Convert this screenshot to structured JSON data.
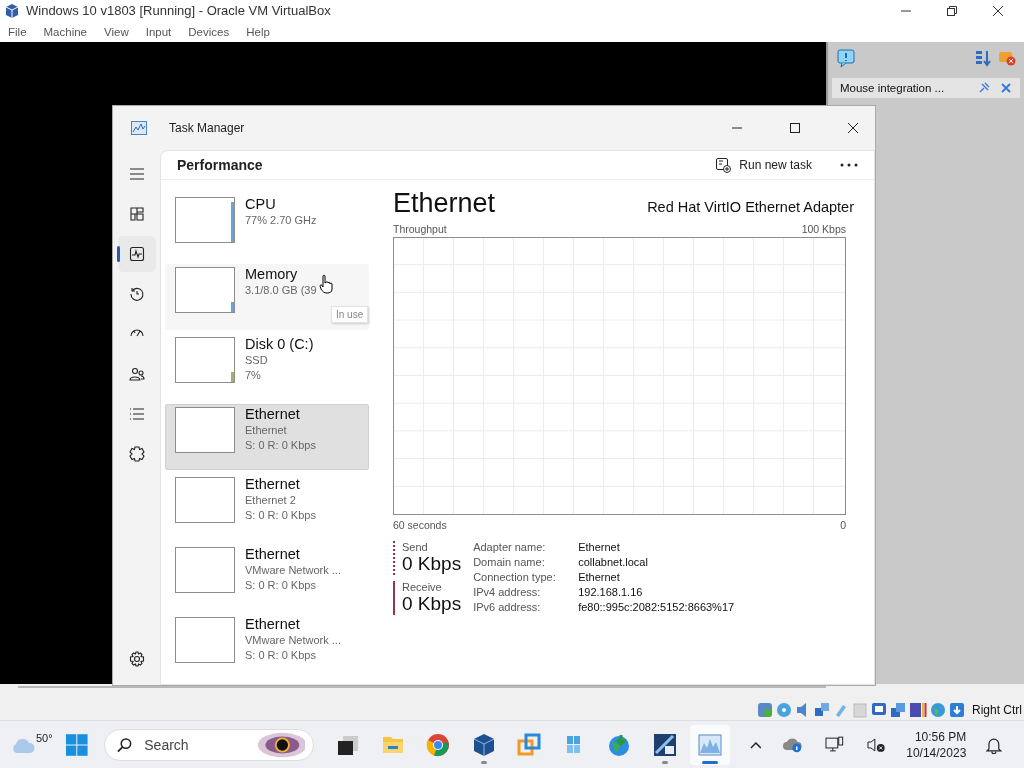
{
  "host_window": {
    "title": "Windows 10 v1803 [Running] - Oracle VM VirtualBox"
  },
  "menu": [
    "File",
    "Machine",
    "View",
    "Input",
    "Devices",
    "Help"
  ],
  "notification": {
    "text": "Mouse integration ..."
  },
  "task_manager": {
    "title": "Task Manager",
    "nav": [
      {
        "kind": "menu",
        "selected": false
      },
      {
        "kind": "processes",
        "selected": false
      },
      {
        "kind": "performance",
        "selected": true
      },
      {
        "kind": "history",
        "selected": false
      },
      {
        "kind": "startup",
        "selected": false
      },
      {
        "kind": "users",
        "selected": false
      },
      {
        "kind": "details",
        "selected": false
      },
      {
        "kind": "services",
        "selected": false
      },
      {
        "kind": "settings",
        "selected": false
      }
    ],
    "page_title": "Performance",
    "run_new_task": "Run new task",
    "devices": [
      {
        "kind": "cpu",
        "name": "CPU",
        "lines": [
          "77% 2.70 GHz"
        ],
        "selected": false,
        "hovered": false
      },
      {
        "kind": "memory",
        "name": "Memory",
        "lines": [
          "3.1/8.0 GB (39"
        ],
        "selected": false,
        "hovered": true
      },
      {
        "kind": "disk",
        "name": "Disk 0 (C:)",
        "lines": [
          "SSD",
          "7%"
        ],
        "selected": false,
        "hovered": false
      },
      {
        "kind": "ethernet",
        "name": "Ethernet",
        "lines": [
          "Ethernet",
          "S: 0 R: 0 Kbps"
        ],
        "selected": true,
        "hovered": false
      },
      {
        "kind": "ethernet",
        "name": "Ethernet",
        "lines": [
          "Ethernet 2",
          "S: 0 R: 0 Kbps"
        ],
        "selected": false,
        "hovered": false
      },
      {
        "kind": "ethernet",
        "name": "Ethernet",
        "lines": [
          "VMware Network ...",
          "S: 0 R: 0 Kbps"
        ],
        "selected": false,
        "hovered": false
      },
      {
        "kind": "ethernet",
        "name": "Ethernet",
        "lines": [
          "VMware Network ...",
          "S: 0 R: 0 Kbps"
        ],
        "selected": false,
        "hovered": false
      }
    ],
    "tooltip": "In use",
    "detail": {
      "title": "Ethernet",
      "adapter": "Red Hat VirtIO Ethernet Adapter",
      "graph_label": "Throughput",
      "graph_max": "100 Kbps",
      "graph_span": "60 seconds",
      "graph_min": "0",
      "send": {
        "label": "Send",
        "value": "0 Kbps"
      },
      "receive": {
        "label": "Receive",
        "value": "0 Kbps"
      },
      "properties": [
        {
          "label": "Adapter name:",
          "value": "Ethernet"
        },
        {
          "label": "Domain name:",
          "value": "collabnet.local"
        },
        {
          "label": "Connection type:",
          "value": "Ethernet"
        },
        {
          "label": "IPv4 address:",
          "value": "192.168.1.16"
        },
        {
          "label": "IPv6 address:",
          "value": "fe80::995c:2082:5152:8663%17"
        }
      ]
    }
  },
  "vm_status_bar": {
    "host_key": "Right Ctrl"
  },
  "taskbar": {
    "weather": "50°",
    "search_placeholder": "Search",
    "apps": [
      {
        "kind": "task-view",
        "running": false,
        "active": false
      },
      {
        "kind": "folder",
        "running": false,
        "active": false
      },
      {
        "kind": "browser",
        "running": false,
        "active": false
      },
      {
        "kind": "cube",
        "running": true,
        "active": false
      },
      {
        "kind": "squares",
        "running": false,
        "active": false
      },
      {
        "kind": "windows",
        "running": false,
        "active": false
      },
      {
        "kind": "globe",
        "running": false,
        "active": false
      },
      {
        "kind": "diagnostic",
        "running": true,
        "active": false
      },
      {
        "kind": "graph",
        "running": true,
        "active": true
      }
    ],
    "time": "10:56 PM",
    "date": "10/14/2023"
  }
}
